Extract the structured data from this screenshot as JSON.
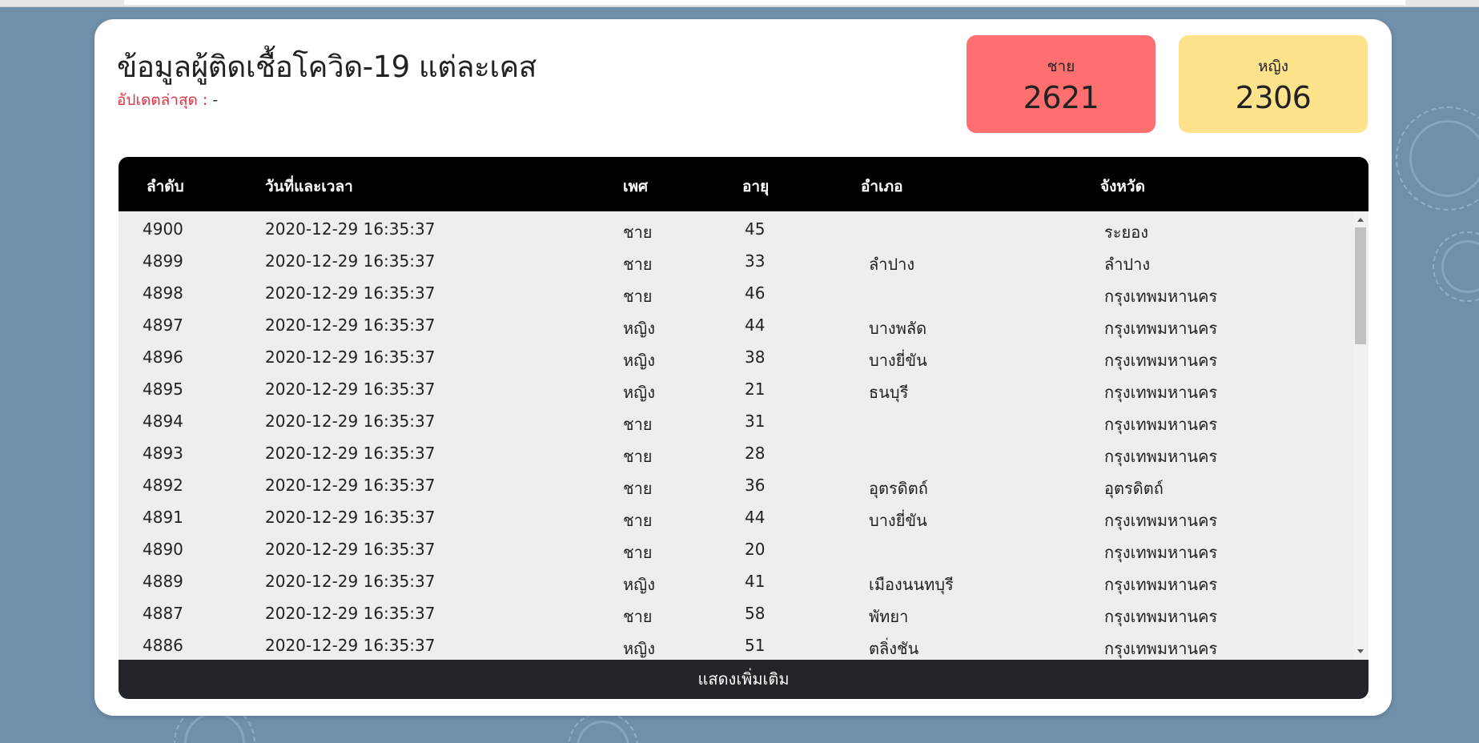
{
  "page": {
    "title": "ข้อมูลผู้ติดเชื้อโควิด-19 แต่ละเคส",
    "updated_label": "อัปเดตล่าสุด :",
    "updated_value": "-"
  },
  "stats": {
    "male": {
      "label": "ชาย",
      "value": "2621",
      "color": "#ff6f6f"
    },
    "female": {
      "label": "หญิง",
      "value": "2306",
      "color": "#ffe38c"
    }
  },
  "table": {
    "headers": [
      "ลำดับ",
      "วันที่และเวลา",
      "เพศ",
      "อายุ",
      "อำเภอ",
      "จังหวัด"
    ],
    "rows": [
      [
        "4900",
        "2020-12-29 16:35:37",
        "ชาย",
        "45",
        "",
        "ระยอง"
      ],
      [
        "4899",
        "2020-12-29 16:35:37",
        "ชาย",
        "33",
        "ลำปาง",
        "ลำปาง"
      ],
      [
        "4898",
        "2020-12-29 16:35:37",
        "ชาย",
        "46",
        "",
        "กรุงเทพมหานคร"
      ],
      [
        "4897",
        "2020-12-29 16:35:37",
        "หญิง",
        "44",
        "บางพลัด",
        "กรุงเทพมหานคร"
      ],
      [
        "4896",
        "2020-12-29 16:35:37",
        "หญิง",
        "38",
        "บางยี่ขัน",
        "กรุงเทพมหานคร"
      ],
      [
        "4895",
        "2020-12-29 16:35:37",
        "หญิง",
        "21",
        "ธนบุรี",
        "กรุงเทพมหานคร"
      ],
      [
        "4894",
        "2020-12-29 16:35:37",
        "ชาย",
        "31",
        "",
        "กรุงเทพมหานคร"
      ],
      [
        "4893",
        "2020-12-29 16:35:37",
        "ชาย",
        "28",
        "",
        "กรุงเทพมหานคร"
      ],
      [
        "4892",
        "2020-12-29 16:35:37",
        "ชาย",
        "36",
        "อุตรดิตถ์",
        "อุตรดิตถ์"
      ],
      [
        "4891",
        "2020-12-29 16:35:37",
        "ชาย",
        "44",
        "บางยี่ขัน",
        "กรุงเทพมหานคร"
      ],
      [
        "4890",
        "2020-12-29 16:35:37",
        "ชาย",
        "20",
        "",
        "กรุงเทพมหานคร"
      ],
      [
        "4889",
        "2020-12-29 16:35:37",
        "หญิง",
        "41",
        "เมืองนนทบุรี",
        "กรุงเทพมหานคร"
      ],
      [
        "4887",
        "2020-12-29 16:35:37",
        "ชาย",
        "58",
        "พัทยา",
        "กรุงเทพมหานคร"
      ],
      [
        "4886",
        "2020-12-29 16:35:37",
        "หญิง",
        "51",
        "ตลิ่งชัน",
        "กรุงเทพมหานคร"
      ]
    ]
  },
  "buttons": {
    "show_more": "แสดงเพิ่มเติม"
  },
  "colors": {
    "background": "#6f8faa",
    "header_bg": "#000000",
    "button_bg": "#212529",
    "updated_label": "#dc3545"
  }
}
